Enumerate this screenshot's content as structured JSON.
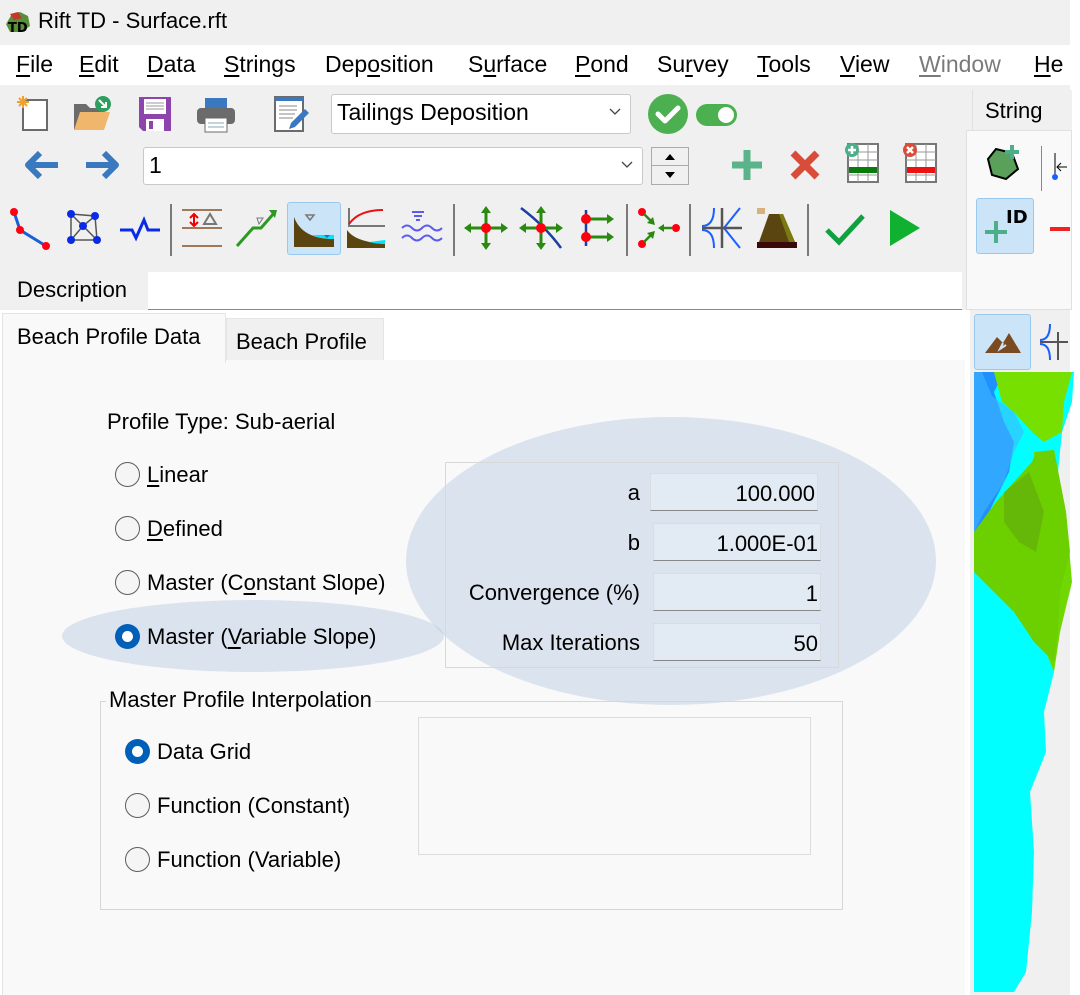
{
  "window": {
    "title": "Rift TD - Surface.rft",
    "app_icon": "rift-td-logo"
  },
  "menu": [
    {
      "pre": "",
      "u": "F",
      "post": "ile",
      "disabled": false
    },
    {
      "pre": "",
      "u": "E",
      "post": "dit",
      "disabled": false
    },
    {
      "pre": "",
      "u": "D",
      "post": "ata",
      "disabled": false
    },
    {
      "pre": "",
      "u": "S",
      "post": "trings",
      "disabled": false
    },
    {
      "pre": "Dep",
      "u": "o",
      "post": "sition",
      "disabled": false
    },
    {
      "pre": "S",
      "u": "u",
      "post": "rface",
      "disabled": false
    },
    {
      "pre": "",
      "u": "P",
      "post": "ond",
      "disabled": false
    },
    {
      "pre": "Su",
      "u": "r",
      "post": "vey",
      "disabled": false
    },
    {
      "pre": "",
      "u": "T",
      "post": "ools",
      "disabled": false
    },
    {
      "pre": "",
      "u": "V",
      "post": "iew",
      "disabled": false
    },
    {
      "pre": "",
      "u": "W",
      "post": "indow",
      "disabled": true
    },
    {
      "pre": "",
      "u": "H",
      "post": "e",
      "disabled": false
    }
  ],
  "toolbar": {
    "row1_icons": [
      "new-file-icon",
      "open-folder-icon",
      "save-icon",
      "print-icon",
      "edit-notes-icon"
    ],
    "mode_select": {
      "value": "Tailings Deposition"
    },
    "status_ok_icon": "check-circle-icon",
    "toggle": {
      "state": "on"
    },
    "row2_icons": [
      "arrow-left-icon",
      "arrow-right-icon"
    ],
    "index_select": {
      "value": "1"
    },
    "row2_actions": [
      "add-icon",
      "delete-icon",
      "add-row-grid-icon",
      "delete-row-grid-icon"
    ],
    "row3_icons": [
      "polyline-icon",
      "mesh-icon",
      "profile-line-icon",
      "layer-offset-icon",
      "slope-line-icon",
      "beach-profile-icon",
      "beach-curve-icon",
      "water-level-icon",
      "move-points-icon",
      "move-along-line-icon",
      "offset-points-icon",
      "merge-points-icon",
      "intersect-lines-icon",
      "embankment-icon",
      "validate-check-icon",
      "run-play-icon"
    ],
    "active_icon": "beach-profile-icon"
  },
  "description": {
    "label": "Description",
    "value": ""
  },
  "right_panel": {
    "tab_label": "String",
    "icons": [
      "polygon-add-icon",
      "string-tool-icon",
      "add-id-icon",
      "remove-icon",
      "terrain-icon",
      "intersect-icon"
    ],
    "add_id_text": "ID"
  },
  "tabs": [
    {
      "label": "Beach Profile Data",
      "active": true
    },
    {
      "label": "Beach Profile",
      "active": false
    }
  ],
  "profile": {
    "type_label": "Profile Type: Sub-aerial",
    "options": [
      {
        "pre": "",
        "u": "L",
        "post": "inear",
        "checked": false
      },
      {
        "pre": "",
        "u": "D",
        "post": "efined",
        "checked": false
      },
      {
        "pre": "Master (C",
        "u": "o",
        "post": "nstant Slope)",
        "checked": false
      },
      {
        "pre": "Master (",
        "u": "V",
        "post": "ariable Slope)",
        "checked": true
      }
    ]
  },
  "parameters": [
    {
      "label": "a",
      "value": "100.000"
    },
    {
      "label": "b",
      "value": "1.000E-01"
    },
    {
      "label": "Convergence (%)",
      "value": "1"
    },
    {
      "label": "Max Iterations",
      "value": "50"
    }
  ],
  "interpolation": {
    "title": "Master Profile Interpolation",
    "options": [
      {
        "label": "Data Grid",
        "checked": true
      },
      {
        "label": "Function (Constant)",
        "checked": false
      },
      {
        "label": "Function (Variable)",
        "checked": false
      }
    ]
  },
  "colors": {
    "accent": "#005fb8",
    "highlight": "#c8d8e8",
    "ok_green": "#4caf50"
  }
}
